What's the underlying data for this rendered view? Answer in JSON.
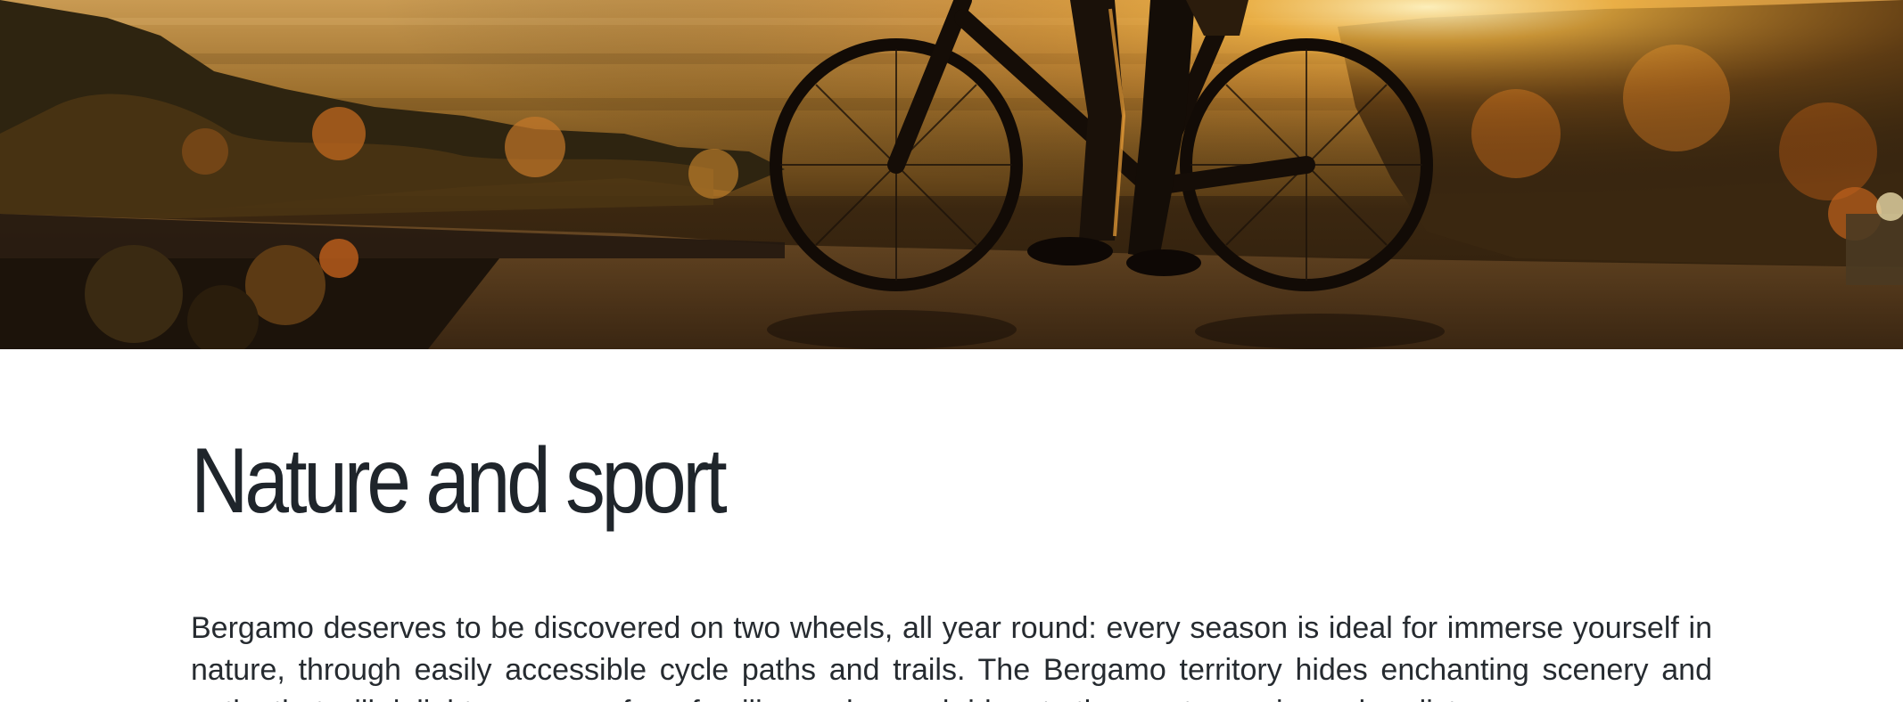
{
  "hero": {
    "image_label": "cyclist-with-mountain-bike-at-sunset"
  },
  "section": {
    "title": "Nature and sport",
    "paragraph": "Bergamo deserves to be discovered on two wheels, all year round: every season is ideal for immerse yourself in nature, through easily accessible cycle paths and trails. The Bergamo territory hides enchanting scenery and paths that will delight everyone, from families and casual riders to the most experienced cyclists."
  }
}
